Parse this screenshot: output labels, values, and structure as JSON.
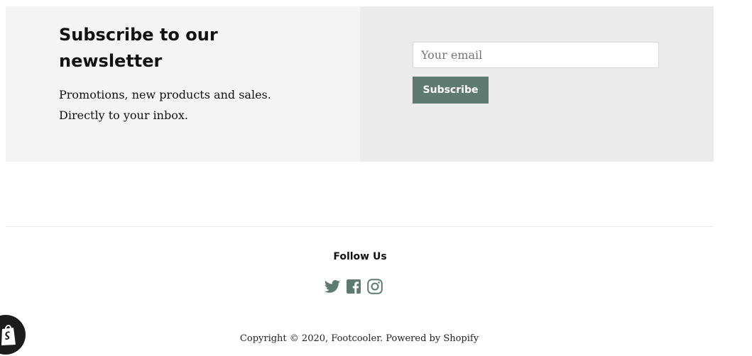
{
  "newsletter": {
    "heading": "Subscribe to our newsletter",
    "text_line1": "Promotions, new products and sales.",
    "text_line2": "Directly to your inbox.",
    "email_placeholder": "Your email",
    "subscribe_label": "Subscribe",
    "accent_color": "#5e7a71"
  },
  "footer": {
    "follow_title": "Follow Us",
    "social": [
      {
        "icon": "twitter-icon"
      },
      {
        "icon": "facebook-icon"
      },
      {
        "icon": "instagram-icon"
      }
    ],
    "copyright_prefix": "Copyright © 2020, ",
    "store_name": "Footcooler",
    "powered_by": "Powered by Shopify"
  },
  "chat_badge": {
    "icon": "shopify-bag-icon"
  }
}
